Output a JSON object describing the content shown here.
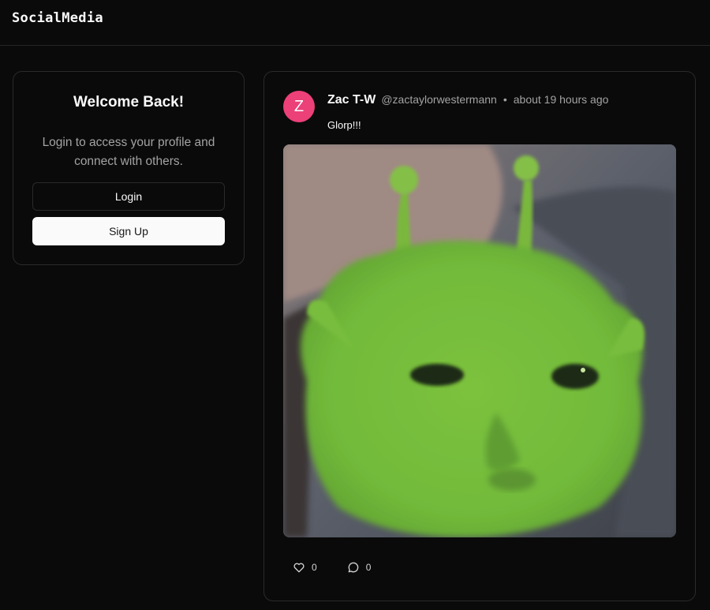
{
  "app": {
    "brand": "SocialMedia"
  },
  "welcome": {
    "title": "Welcome Back!",
    "description": "Login to access your profile and connect with others.",
    "login_label": "Login",
    "signup_label": "Sign Up"
  },
  "post": {
    "avatar_initial": "Z",
    "author_name": "Zac T-W",
    "author_handle": "@zactaylorwestermann",
    "separator": "•",
    "time": "about 19 hours ago",
    "text": "Glorp!!!",
    "image_icon": "green-alien-cat-image",
    "likes": "0",
    "comments": "0",
    "avatar_color": "#ec4079"
  },
  "colors": {
    "background": "#0a0a0a",
    "border": "#2a2a2a",
    "muted_text": "#a3a3a3",
    "primary_button": "#fafafa"
  },
  "icons": {
    "like": "heart-icon",
    "comment": "comment-bubble-icon"
  }
}
